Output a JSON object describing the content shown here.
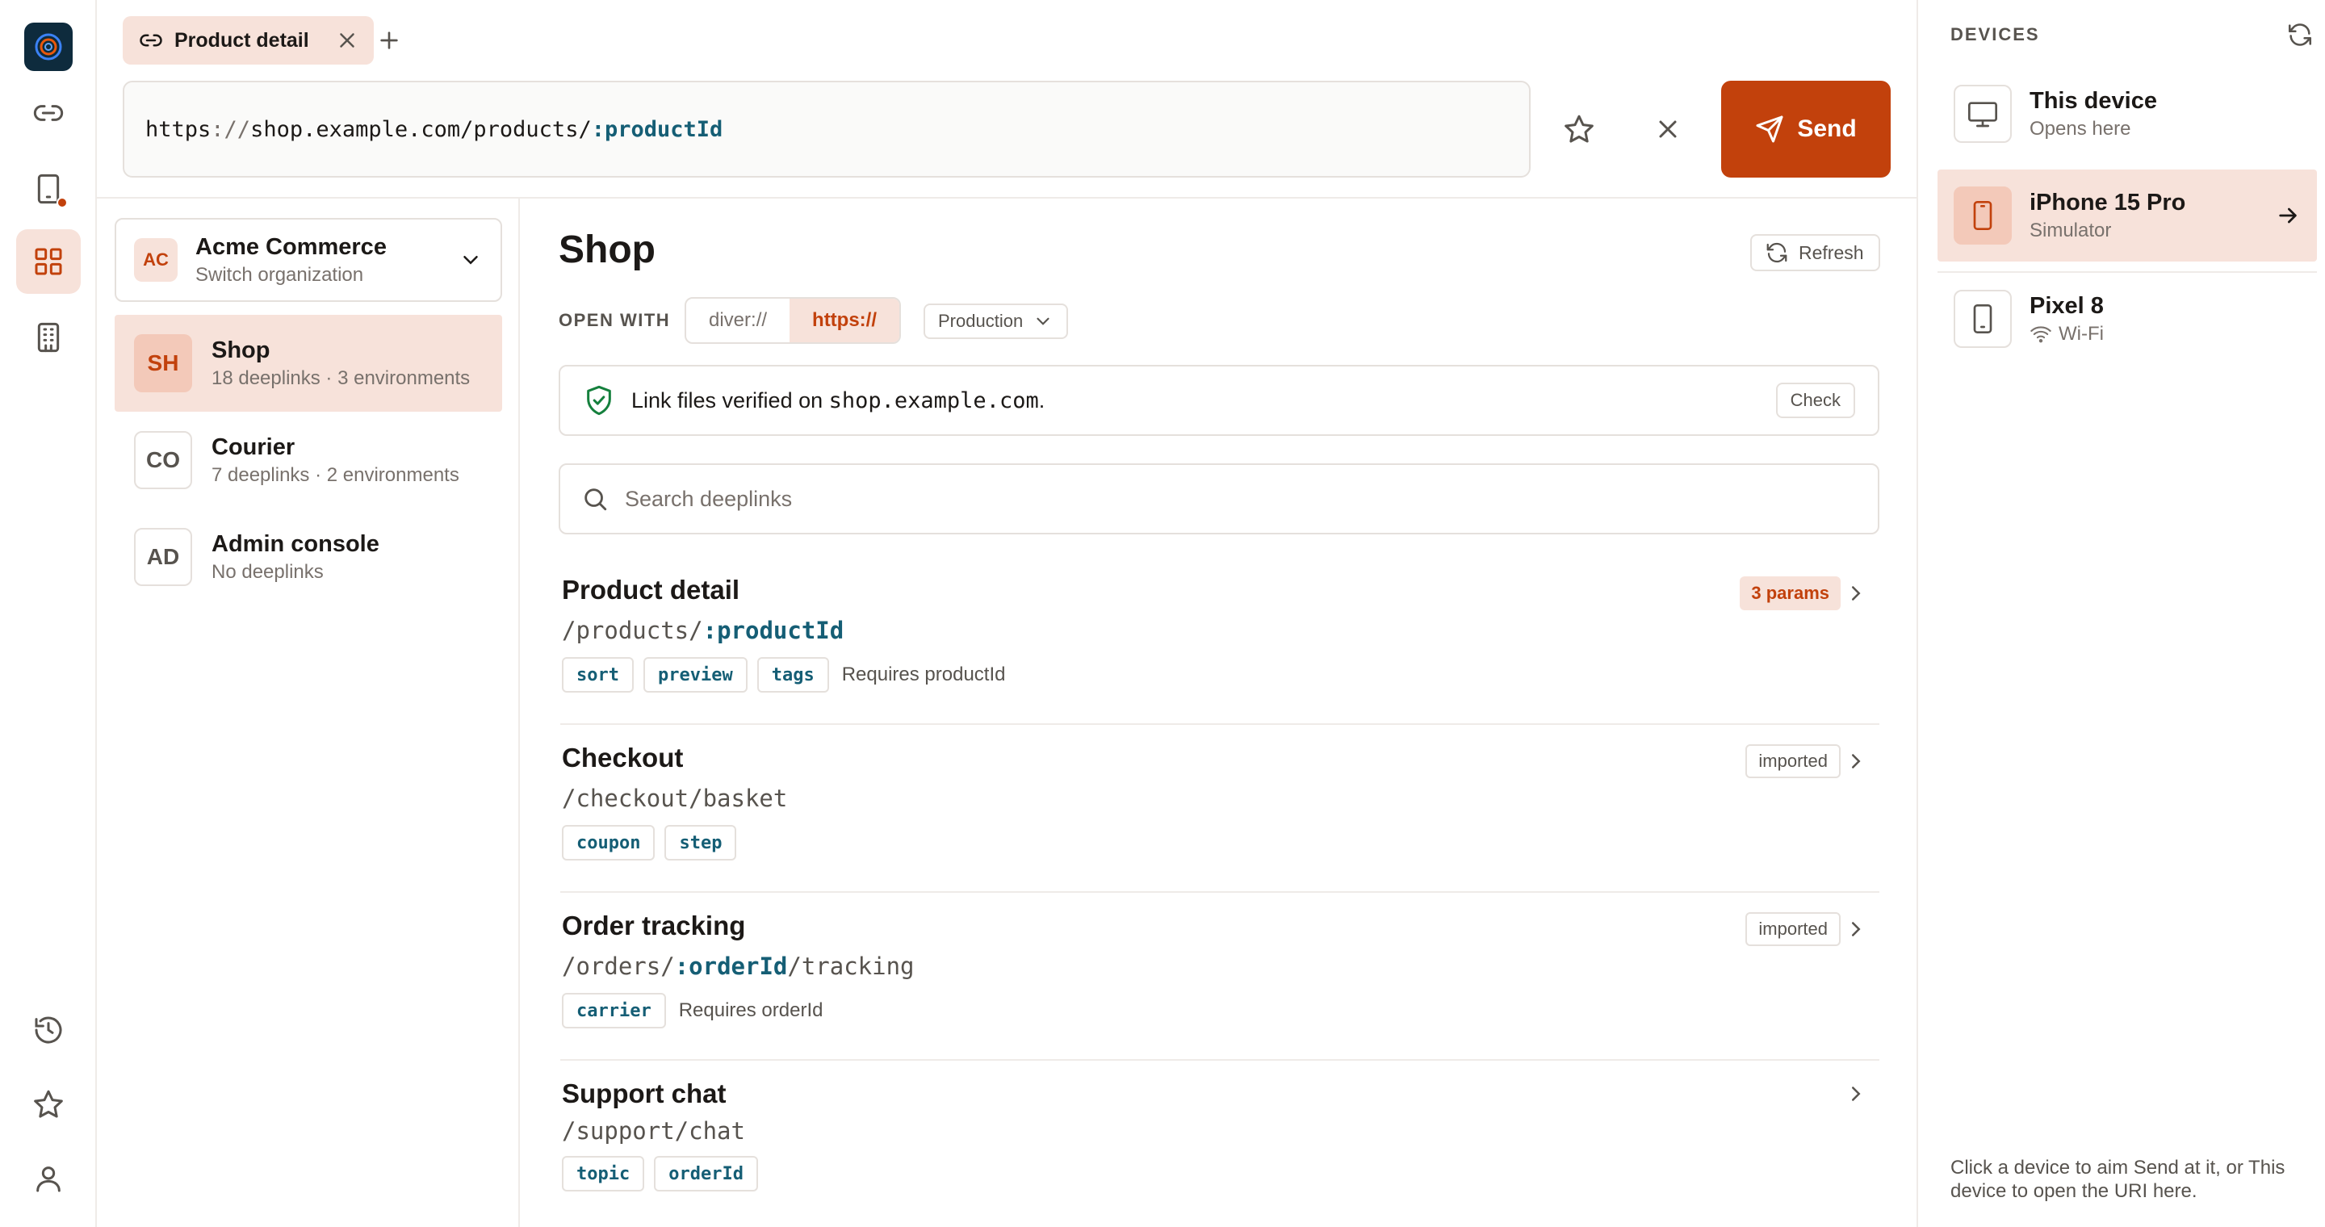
{
  "tab": {
    "label": "Product detail"
  },
  "url": {
    "scheme": "https",
    "sep": "://",
    "host_path": "shop.example.com/products/",
    "param": ":productId"
  },
  "send": {
    "label": "Send"
  },
  "org": {
    "initials": "AC",
    "name": "Acme Commerce",
    "subtitle": "Switch organization"
  },
  "projects": [
    {
      "initials": "SH",
      "name": "Shop",
      "subtitle": "18 deeplinks · 3 environments",
      "active": true
    },
    {
      "initials": "CO",
      "name": "Courier",
      "subtitle": "7 deeplinks · 2 environments"
    },
    {
      "initials": "AD",
      "name": "Admin console",
      "subtitle": "No deeplinks"
    }
  ],
  "main": {
    "title": "Shop",
    "refresh_label": "Refresh",
    "open_with_label": "OPEN WITH",
    "schemes": [
      "diver://",
      "https://"
    ],
    "environment": "Production",
    "verify": {
      "prefix": "Link files verified on ",
      "domain": "shop.example.com",
      "suffix": ".",
      "check_label": "Check"
    },
    "search_placeholder": "Search deeplinks",
    "deeplinks": [
      {
        "name": "Product detail",
        "path_pre": "/products/",
        "path_param": ":productId",
        "path_post": "",
        "chips": [
          "sort",
          "preview",
          "tags"
        ],
        "requires": "Requires productId",
        "badge": "3 params"
      },
      {
        "name": "Checkout",
        "path_pre": "/checkout/basket",
        "path_param": "",
        "path_post": "",
        "chips": [
          "coupon",
          "step"
        ],
        "requires": "",
        "badge": "imported"
      },
      {
        "name": "Order tracking",
        "path_pre": "/orders/",
        "path_param": ":orderId",
        "path_post": "/tracking",
        "chips": [
          "carrier"
        ],
        "requires": "Requires orderId",
        "badge": "imported"
      },
      {
        "name": "Support chat",
        "path_pre": "/support/chat",
        "path_param": "",
        "path_post": "",
        "chips": [
          "topic",
          "orderId"
        ],
        "requires": "",
        "badge": ""
      }
    ]
  },
  "devices": {
    "title": "DEVICES",
    "items": [
      {
        "name": "This device",
        "subtitle": "Opens here",
        "icon": "monitor-icon"
      },
      {
        "name": "iPhone 15 Pro",
        "subtitle": "Simulator",
        "icon": "phone-icon",
        "active": true
      },
      {
        "name": "Pixel 8",
        "subtitle": "Wi-Fi",
        "icon": "phone-icon"
      }
    ],
    "hint": "Click a device to aim Send at it, or This device to open the URI here."
  },
  "colors": {
    "accent": "#c2410c",
    "accent_soft": "#f7e2da",
    "param": "#155e75",
    "verified": "#15803d"
  }
}
